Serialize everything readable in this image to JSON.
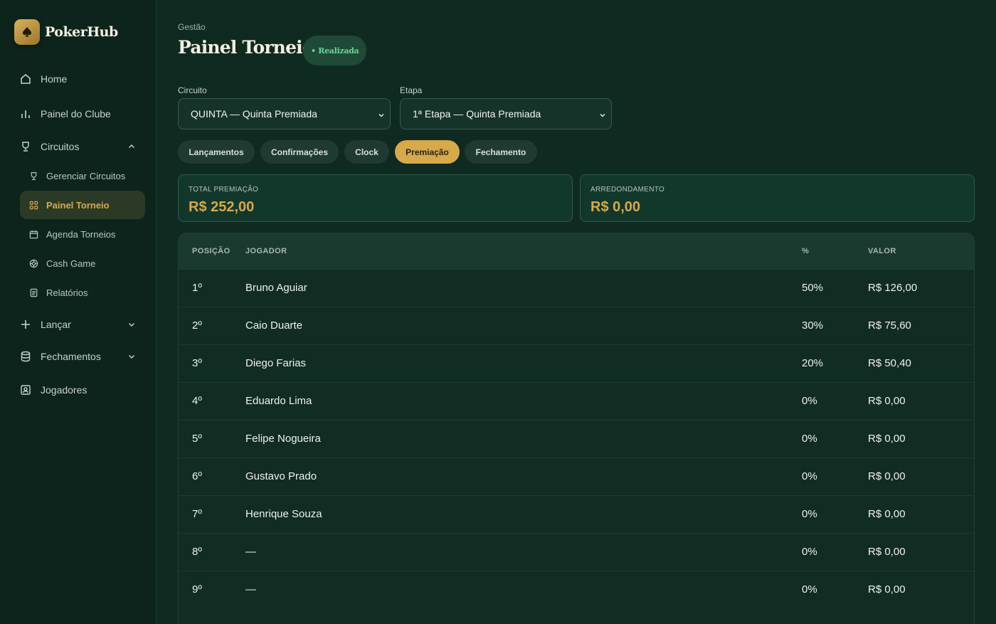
{
  "brand": {
    "name": "PokerHub"
  },
  "sidebar": {
    "items": [
      {
        "label": "Home"
      },
      {
        "label": "Painel do Clube"
      },
      {
        "label": "Circuitos"
      },
      {
        "label": "Lançar"
      },
      {
        "label": "Fechamentos"
      },
      {
        "label": "Jogadores"
      }
    ],
    "circuitos_sub": [
      {
        "label": "Gerenciar Circuitos"
      },
      {
        "label": "Painel Torneio"
      },
      {
        "label": "Agenda Torneios"
      },
      {
        "label": "Cash Game"
      },
      {
        "label": "Relatórios"
      }
    ]
  },
  "header": {
    "breadcrumb": "Gestão",
    "title": "Painel Torneio",
    "status": "• Realizada"
  },
  "filters": {
    "circuito_label": "Circuito",
    "circuito_value": "QUINTA — Quinta Premiada",
    "etapa_label": "Etapa",
    "etapa_value": "1ª Etapa — Quinta Premiada"
  },
  "tabs": [
    {
      "label": "Lançamentos"
    },
    {
      "label": "Confirmações"
    },
    {
      "label": "Clock"
    },
    {
      "label": "Premiação"
    },
    {
      "label": "Fechamento"
    }
  ],
  "stats": {
    "total_label": "TOTAL PREMIAÇÃO",
    "total_value": "R$ 252,00",
    "round_label": "ARREDONDAMENTO",
    "round_value": "R$ 0,00"
  },
  "table": {
    "headers": {
      "pos": "POSIÇÃO",
      "player": "JOGADOR",
      "pct": "%",
      "value": "VALOR"
    },
    "rows": [
      {
        "pos": "1º",
        "player": "Bruno Aguiar",
        "pct": "50%",
        "value": "R$ 126,00"
      },
      {
        "pos": "2º",
        "player": "Caio Duarte",
        "pct": "30%",
        "value": "R$ 75,60"
      },
      {
        "pos": "3º",
        "player": "Diego Farias",
        "pct": "20%",
        "value": "R$ 50,40"
      },
      {
        "pos": "4º",
        "player": "Eduardo Lima",
        "pct": "0%",
        "value": "R$ 0,00"
      },
      {
        "pos": "5º",
        "player": "Felipe Nogueira",
        "pct": "0%",
        "value": "R$ 0,00"
      },
      {
        "pos": "6º",
        "player": "Gustavo Prado",
        "pct": "0%",
        "value": "R$ 0,00"
      },
      {
        "pos": "7º",
        "player": "Henrique Souza",
        "pct": "0%",
        "value": "R$ 0,00"
      },
      {
        "pos": "8º",
        "player": "—",
        "pct": "0%",
        "value": "R$ 0,00"
      },
      {
        "pos": "9º",
        "player": "—",
        "pct": "0%",
        "value": "R$ 0,00"
      }
    ]
  },
  "colors": {
    "accent": "#d6a94a",
    "background": "#0f2a21",
    "status": "#6fd39a"
  }
}
